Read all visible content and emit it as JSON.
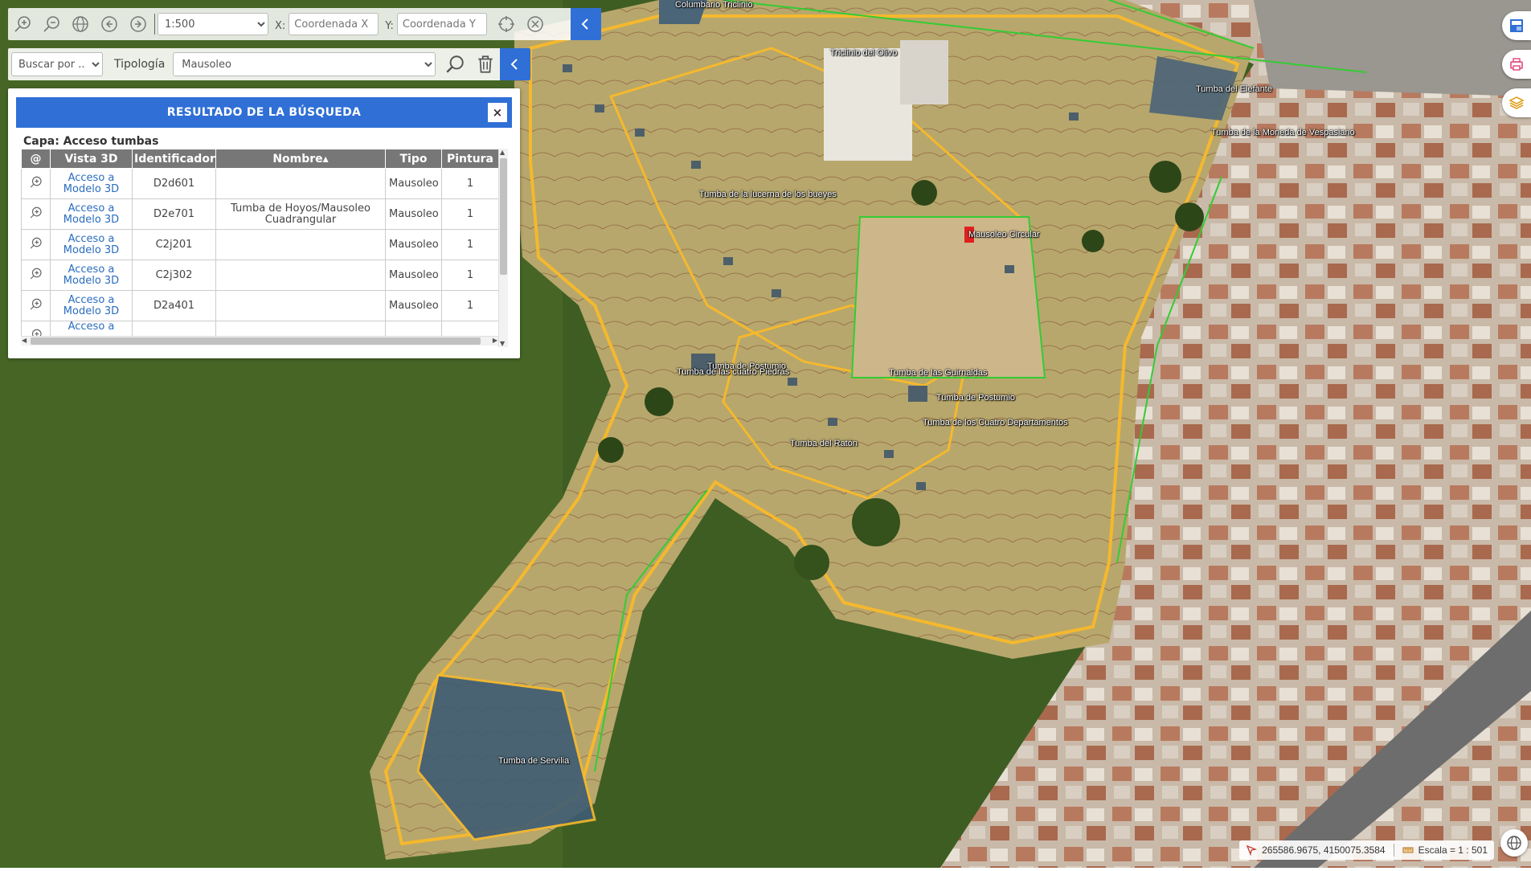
{
  "toolbar": {
    "scale_value": "1:500",
    "scale_options": [
      "1:500"
    ],
    "x_label": "X:",
    "x_placeholder": "Coordenada X",
    "y_label": "Y:",
    "y_placeholder": "Coordenada Y"
  },
  "search": {
    "buscar_placeholder": "Buscar por ...",
    "tipologia_label": "Tipología",
    "tipologia_value": "Mausoleo"
  },
  "results": {
    "title": "RESULTADO DE LA BÚSQUEDA",
    "close_label": "×",
    "layer_title": "Capa: Acceso tumbas",
    "columns": [
      "@",
      "Vista 3D",
      "Identificador",
      "Nombre▴",
      "Tipo",
      "Pintura"
    ],
    "rows": [
      {
        "vista": "Acceso a Modelo 3D",
        "id": "D2d601",
        "nombre": "",
        "tipo": "Mausoleo",
        "pintura": "1"
      },
      {
        "vista": "Acceso a Modelo 3D",
        "id": "D2e701",
        "nombre": "Tumba de Hoyos/Mausoleo Cuadrangular",
        "tipo": "Mausoleo",
        "pintura": "1"
      },
      {
        "vista": "Acceso a Modelo 3D",
        "id": "C2j201",
        "nombre": "",
        "tipo": "Mausoleo",
        "pintura": "1"
      },
      {
        "vista": "Acceso a Modelo 3D",
        "id": "C2j302",
        "nombre": "",
        "tipo": "Mausoleo",
        "pintura": "1"
      },
      {
        "vista": "Acceso a Modelo 3D",
        "id": "D2a401",
        "nombre": "",
        "tipo": "Mausoleo",
        "pintura": "1"
      },
      {
        "vista": "Acceso a",
        "id": "",
        "nombre": "",
        "tipo": "",
        "pintura": ""
      }
    ]
  },
  "map_labels": [
    "Columbario Triclinio",
    "Triclinio del Olivo",
    "Tumba del Elefante",
    "Tumba de la Moneda de Vespasiano",
    "Tumba de la lucerna de los bueyes",
    "Mausoleo Circular",
    "Tumba de Postumio",
    "Tumba de las cuatro Piedras",
    "Tumba de las Guirnaldas",
    "Tumba de Postumio",
    "Tumba de los Cuatro Departamentos",
    "Tumba del Ratón",
    "Tumba de Servilia"
  ],
  "status": {
    "coordinates": "265586.9675, 4150075.3584",
    "scale": "Escala = 1 : 501"
  },
  "colors": {
    "accent": "#2f6fd6",
    "map_green": "#3e5d22",
    "path_yellow": "#f5b82e"
  }
}
